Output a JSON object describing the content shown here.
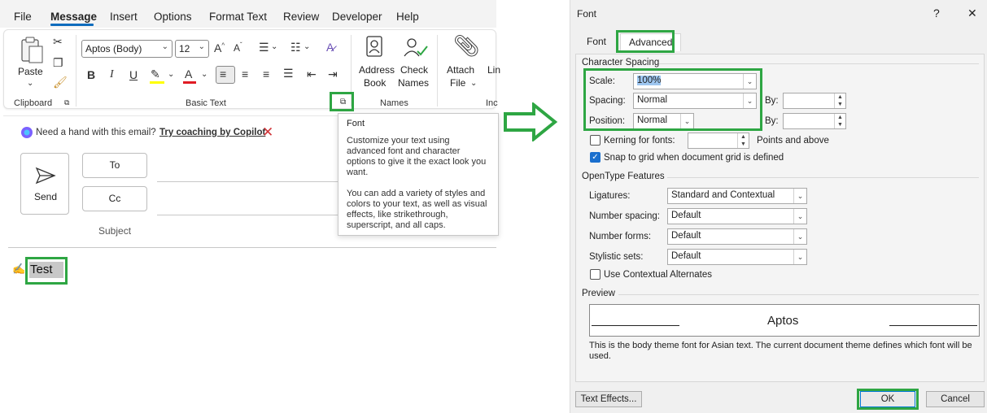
{
  "menu": {
    "items": [
      "File",
      "Message",
      "Insert",
      "Options",
      "Format Text",
      "Review",
      "Developer",
      "Help"
    ],
    "active": "Message"
  },
  "ribbon": {
    "paste_label": "Paste",
    "clipboard_label": "Clipboard",
    "font_name": "Aptos (Body)",
    "font_size": "12",
    "basic_text_label": "Basic Text",
    "address_book_line1": "Address",
    "address_book_line2": "Book",
    "check_names_line1": "Check",
    "check_names_line2": "Names",
    "names_label": "Names",
    "attach_line1": "Attach",
    "attach_line2": "File",
    "link_partial": "Lin",
    "include_partial": "Inc",
    "bold": "B",
    "italic": "I",
    "underline": "U"
  },
  "tooltip": {
    "title": "Font",
    "para1": "Customize your text using advanced font and character options to give it the exact look you want.",
    "para2": "You can add a variety of styles and colors to your text, as well as visual effects, like strikethrough, superscript, and all caps."
  },
  "compose": {
    "copilot_prompt": "Need a hand with this email?",
    "copilot_link": "Try coaching by Copilot",
    "send_label": "Send",
    "to_label": "To",
    "cc_label": "Cc",
    "subject_label": "Subject",
    "body_text": "Test"
  },
  "dialog": {
    "title": "Font",
    "help": "?",
    "close": "✕",
    "tabs": [
      "Font",
      "Advanced"
    ],
    "active_tab": "Advanced",
    "character_spacing": {
      "section": "Character Spacing",
      "scale_label": "Scale:",
      "scale_value": "100%",
      "spacing_label": "Spacing:",
      "spacing_value": "Normal",
      "position_label": "Position:",
      "position_value": "Normal",
      "by_label": "By:",
      "by_label2": "By:",
      "kerning_label": "Kerning for fonts:",
      "points_label": "Points and above",
      "snap_label": "Snap to grid when document grid is defined"
    },
    "opentype": {
      "section": "OpenType Features",
      "ligatures_label": "Ligatures:",
      "ligatures_value": "Standard and Contextual",
      "number_spacing_label": "Number spacing:",
      "number_spacing_value": "Default",
      "number_forms_label": "Number forms:",
      "number_forms_value": "Default",
      "stylistic_label": "Stylistic sets:",
      "stylistic_value": "Default",
      "contextual_label": "Use Contextual Alternates"
    },
    "preview": {
      "section": "Preview",
      "sample": "Aptos",
      "note": "This is the body theme font for Asian text. The current document theme defines which font will be used."
    },
    "buttons": {
      "text_effects": "Text Effects...",
      "ok": "OK",
      "cancel": "Cancel"
    }
  },
  "colors": {
    "highlight_box": "#2ea643",
    "accent": "#0f6cbd"
  }
}
